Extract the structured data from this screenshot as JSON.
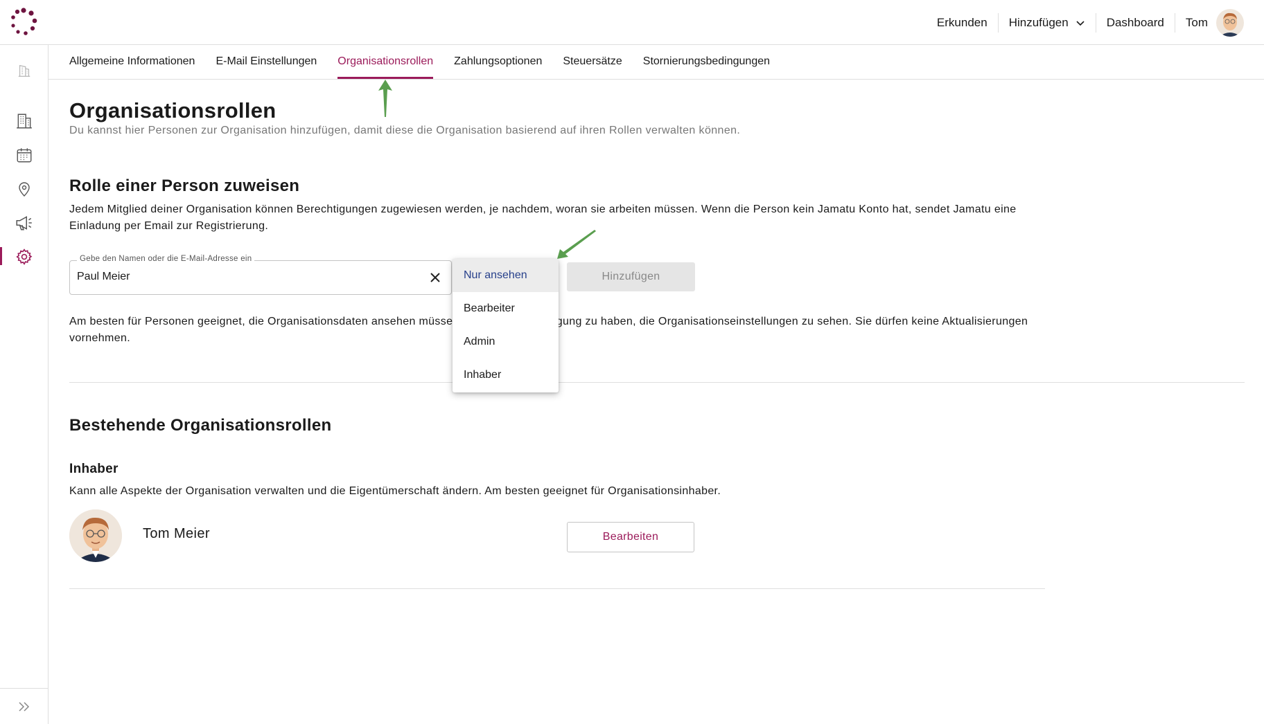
{
  "header": {
    "nav": {
      "explore": "Erkunden",
      "add": "Hinzufügen",
      "dashboard": "Dashboard",
      "user": "Tom"
    }
  },
  "sidebar": {
    "icons": [
      "building-outline-icon",
      "building-icon",
      "calendar-icon",
      "location-pin-icon",
      "megaphone-icon",
      "settings-gear-icon"
    ],
    "active": "settings-gear-icon",
    "expand_icon": "double-chevron-right-icon"
  },
  "tabs": [
    {
      "label": "Allgemeine Informationen",
      "active": false
    },
    {
      "label": "E-Mail Einstellungen",
      "active": false
    },
    {
      "label": "Organisationsrollen",
      "active": true
    },
    {
      "label": "Zahlungsoptionen",
      "active": false
    },
    {
      "label": "Steuersätze",
      "active": false
    },
    {
      "label": "Stornierungsbedingungen",
      "active": false
    }
  ],
  "page": {
    "title": "Organisationsrollen",
    "subtitle": "Du kannst hier Personen zur Organisation hinzufügen, damit diese die Organisation basierend auf ihren Rollen verwalten können."
  },
  "assign": {
    "heading": "Rolle einer Person zuweisen",
    "description": "Jedem Mitglied deiner Organisation können Berechtigungen zugewiesen werden, je nachdem, woran sie arbeiten müssen. Wenn die Person kein Jamatu Konto hat, sendet Jamatu eine Einladung per Email zur Registrierung.",
    "input_label": "Gebe den Namen oder die E-Mail-Adresse ein",
    "input_value": "Paul Meier",
    "add_button": "Hinzufügen",
    "role_hint": "Am besten für Personen geeignet, die Organisationsdaten ansehen müssen, ohne die Berechtigung zu haben, die Organisationseinstellungen zu sehen. Sie dürfen keine Aktualisierungen vornehmen.",
    "dropdown": {
      "options": [
        "Nur ansehen",
        "Bearbeiter",
        "Admin",
        "Inhaber"
      ],
      "selected": "Nur ansehen"
    }
  },
  "existing": {
    "heading": "Bestehende Organisationsrollen",
    "role_title": "Inhaber",
    "role_description": "Kann alle Aspekte der Organisation verwalten und die Eigentümerschaft ändern. Am besten geeignet für Organisationsinhaber.",
    "member_name": "Tom Meier",
    "edit_button": "Bearbeiten"
  },
  "colors": {
    "accent": "#9b1b5a",
    "selected_option": "#27408b",
    "annotation_arrow": "#5a9e4f"
  }
}
